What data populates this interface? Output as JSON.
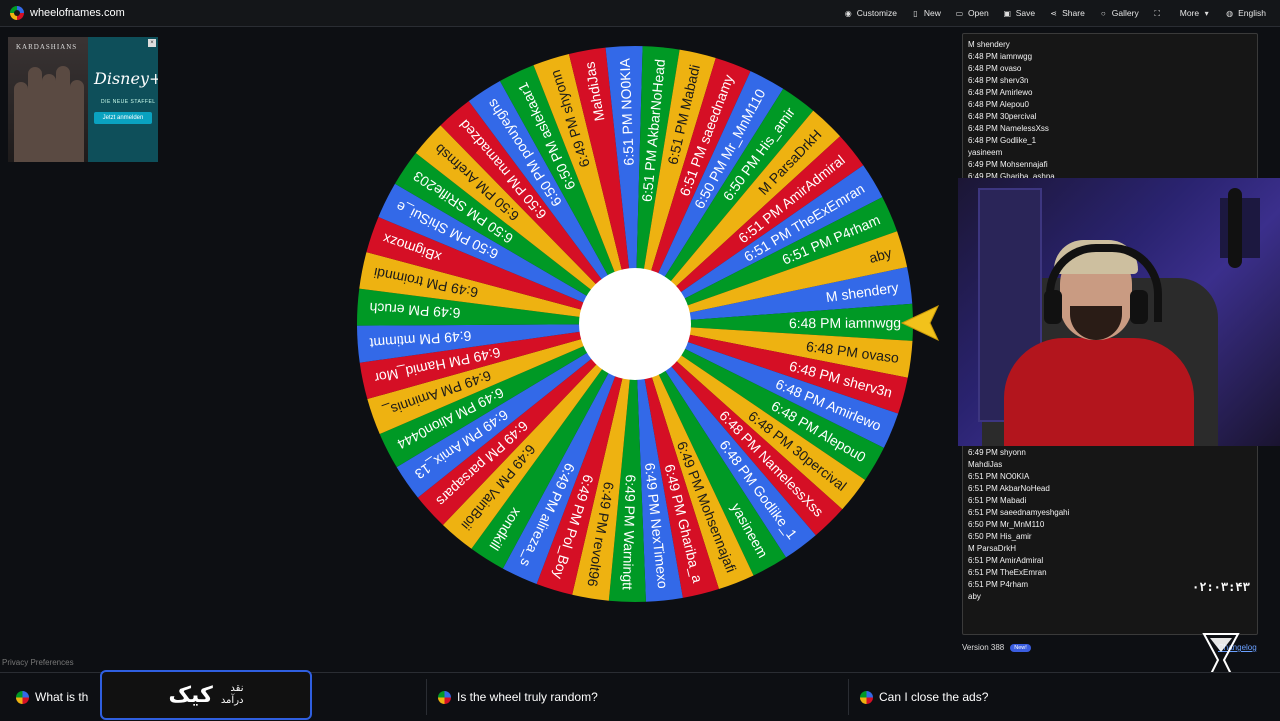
{
  "header": {
    "site_name": "wheelofnames.com",
    "nav": [
      {
        "label": "Customize",
        "icon": "palette-icon"
      },
      {
        "label": "New",
        "icon": "file-icon"
      },
      {
        "label": "Open",
        "icon": "folder-icon"
      },
      {
        "label": "Save",
        "icon": "save-icon"
      },
      {
        "label": "Share",
        "icon": "share-icon"
      },
      {
        "label": "Gallery",
        "icon": "search-icon"
      },
      {
        "label": "",
        "icon": "fullscreen-icon"
      },
      {
        "label": "More",
        "icon": "chevron-down-icon"
      },
      {
        "label": "English",
        "icon": "globe-icon"
      }
    ]
  },
  "ad": {
    "brand": "KARDASHIANS",
    "logo": "Disney+",
    "subtitle": "DIE NEUE STAFFEL",
    "cta": "Jetzt anmelden"
  },
  "privacy_label": "Privacy Preferences",
  "wheel": {
    "colors": [
      "#3369e8",
      "#009925",
      "#eeb211",
      "#d50f25"
    ],
    "segments": [
      "M shendery",
      "6:48 PM iamnwgg",
      "6:48 PM ovaso",
      "6:48 PM sherv3n",
      "6:48 PM Amirlewo",
      "6:48 PM Alepou0",
      "6:48 PM 30percival",
      "6:48 PM NamelessXss",
      "6:48 PM Godlike_1",
      "yasineem",
      "6:49 PM Mohsennajafi",
      "6:49 PM Ghariba_a",
      "6:49 PM NexTimexo",
      "6:49 PM Warningtt",
      "6:49 PM revolt96",
      "6:49 PM Pol_Boy",
      "6:49 PM alireza_s",
      "xondkill",
      "6:49 PM VainBoii",
      "6:49 PM parsapars",
      "6:49 PM Amix_13",
      "6:49 PM Alion0444",
      "6:49 PM Aminnis_",
      "6:49 PM Hamid_Mor",
      "6:49 PM mtimmt",
      "6:49 PM eruch",
      "6:49 PM troimndi",
      "xBigmozx",
      "6:50 PM ShiSui_e",
      "6:50 PM SRifle203",
      "6:50 PM Arefmsb",
      "6:50 PM mamadzed",
      "6:50 PM poouyeghs",
      "6:50 PM aslekaar1",
      "6:49 PM shyonn",
      "MahdiJas",
      "6:51 PM NO0KIA",
      "6:51 PM AkbarNoHead",
      "6:51 PM Mabadi",
      "6:51 PM saeednamy",
      "6:50 PM Mr_MnM110",
      "6:50 PM His_amir",
      "M ParsaDrkH",
      "6:51 PM AmirAdmiral",
      "6:51 PM TheExEmran",
      "6:51 PM P4rham",
      "aby"
    ]
  },
  "entries_top": [
    "M shendery",
    "6:48 PM iamnwgg",
    "6:48 PM ovaso",
    "6:48 PM sherv3n",
    "6:48 PM Amirlewo",
    "6:48 PM Alepou0",
    "6:48 PM 30percival",
    "6:48 PM NamelessXss",
    "6:48 PM Godlike_1",
    "yasineem",
    "6:49 PM Mohsennajafi",
    "6:49 PM Ghariba_ashna"
  ],
  "entries_bottom": [
    "6:49 PM shyonn",
    "MahdiJas",
    "6:51 PM NO0KIA",
    "6:51 PM AkbarNoHead",
    "6:51 PM Mabadi",
    "6:51 PM saeednamyeshgahi",
    "6:50 PM Mr_MnM110",
    "6:50 PM His_amir",
    "M ParsaDrkH",
    "6:51 PM AmirAdmiral",
    "6:51 PM TheExEmran",
    "6:51 PM P4rham",
    "aby"
  ],
  "version": {
    "label": "Version 388",
    "badge": "New!",
    "changelog": "Changelog"
  },
  "timer": "۰۲:۰۳:۴۳",
  "faq": [
    "What is th",
    "Is the wheel truly random?",
    "Can I close the ads?"
  ],
  "kick_overlay": {
    "logo": "کیک",
    "line1": "نقد",
    "line2": "درآمد"
  }
}
